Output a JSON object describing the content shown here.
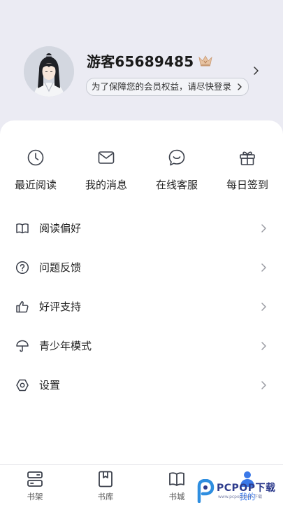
{
  "profile": {
    "username": "游客65689485",
    "login_prompt": "为了保障您的会员权益，请尽快登录"
  },
  "quick_actions": [
    {
      "label": "最近阅读",
      "icon": "clock-icon"
    },
    {
      "label": "我的消息",
      "icon": "mail-icon"
    },
    {
      "label": "在线客服",
      "icon": "customer-service-icon"
    },
    {
      "label": "每日签到",
      "icon": "gift-icon"
    }
  ],
  "menu": [
    {
      "label": "阅读偏好",
      "icon": "book-open-icon"
    },
    {
      "label": "问题反馈",
      "icon": "question-icon"
    },
    {
      "label": "好评支持",
      "icon": "thumbs-up-icon"
    },
    {
      "label": "青少年模式",
      "icon": "umbrella-icon"
    },
    {
      "label": "设置",
      "icon": "settings-hex-icon"
    }
  ],
  "tabbar": [
    {
      "label": "书架",
      "icon": "bookshelf-icon",
      "active": false
    },
    {
      "label": "书库",
      "icon": "bookmark-icon",
      "active": false
    },
    {
      "label": "书城",
      "icon": "open-book-icon",
      "active": false
    },
    {
      "label": "我的",
      "icon": "user-icon",
      "active": true
    }
  ],
  "watermark": {
    "brand": "PCPOP下载",
    "sub": "www.pcpop.com 下载"
  },
  "colors": {
    "background": "#ebebf3",
    "accent": "#3a78e8",
    "icon_stroke": "#3a3f4a",
    "crown": "#d9a878"
  }
}
